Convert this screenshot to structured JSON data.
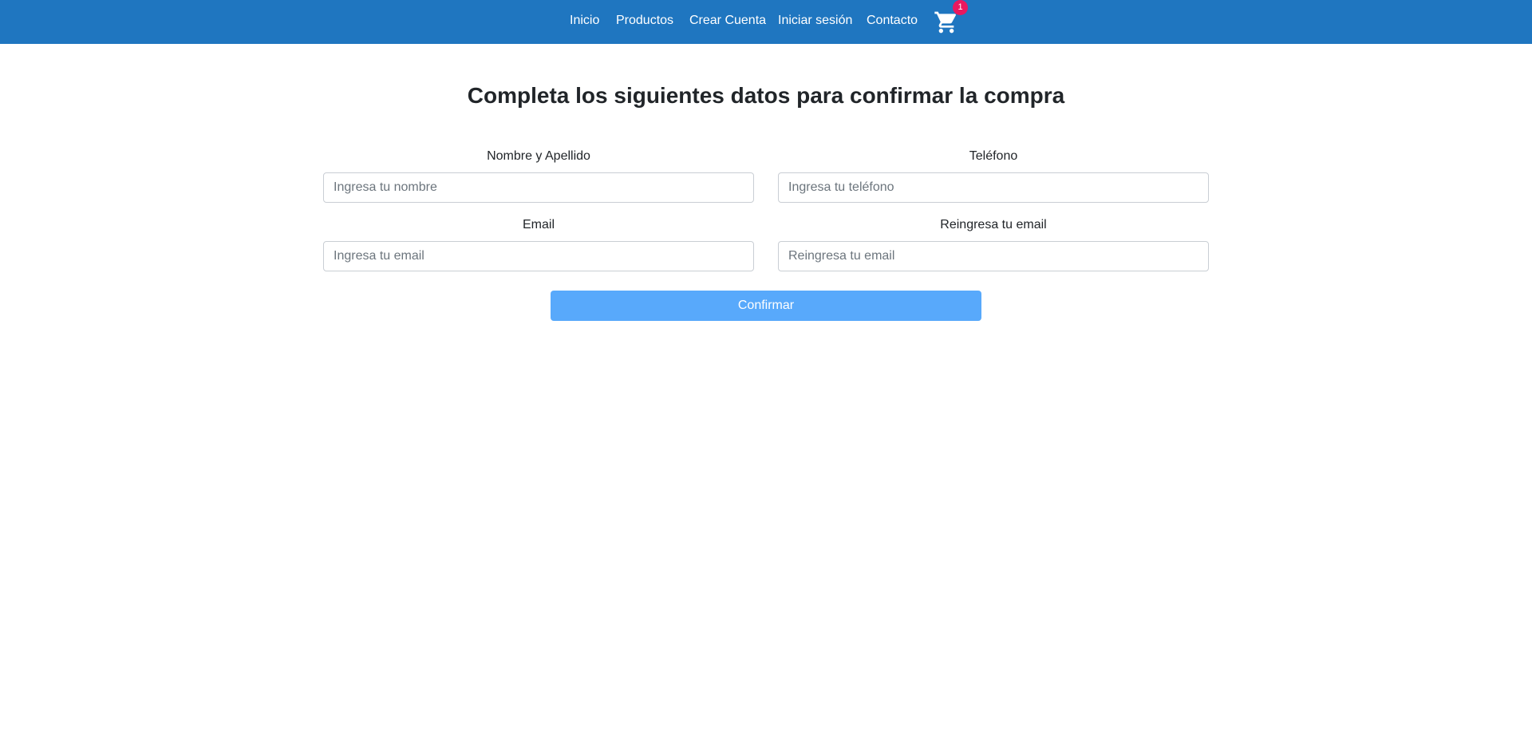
{
  "navbar": {
    "links": [
      {
        "label": "Inicio"
      },
      {
        "label": "Productos"
      },
      {
        "label": "Crear Cuenta"
      },
      {
        "label": "Iniciar sesión"
      },
      {
        "label": "Contacto"
      }
    ],
    "cart": {
      "icon": "cart-icon",
      "badge_count": "1"
    }
  },
  "colors": {
    "navbar_bg": "#1f76c0",
    "badge_bg": "#e8185f",
    "button_bg": "#58a9fb"
  },
  "form": {
    "title": "Completa los siguientes datos para confirmar la compra",
    "fields": {
      "name": {
        "label": "Nombre y Apellido",
        "placeholder": "Ingresa tu nombre",
        "value": ""
      },
      "phone": {
        "label": "Teléfono",
        "placeholder": "Ingresa tu teléfono",
        "value": ""
      },
      "email": {
        "label": "Email",
        "placeholder": "Ingresa tu email",
        "value": ""
      },
      "email_confirm": {
        "label": "Reingresa tu email",
        "placeholder": "Reingresa tu email",
        "value": ""
      }
    },
    "submit_label": "Confirmar"
  }
}
